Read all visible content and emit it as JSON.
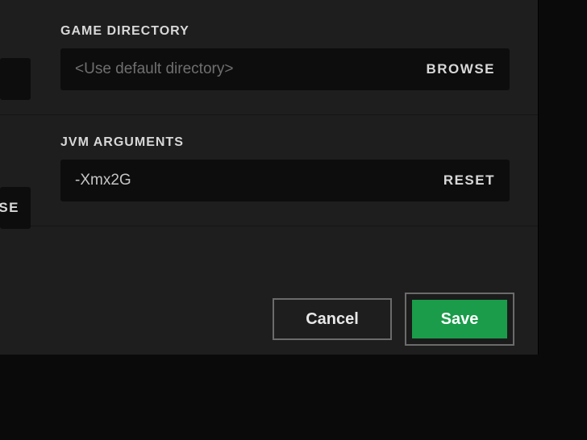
{
  "gameDirectory": {
    "label": "GAME DIRECTORY",
    "placeholder": "<Use default directory>",
    "value": "",
    "browse": "BROWSE"
  },
  "jvmArguments": {
    "label": "JVM ARGUMENTS",
    "value": "-Xmx2G",
    "reset": "RESET"
  },
  "cutoff": {
    "topFragment": "",
    "midFragment": "SE"
  },
  "buttons": {
    "cancel": "Cancel",
    "save": "Save"
  }
}
